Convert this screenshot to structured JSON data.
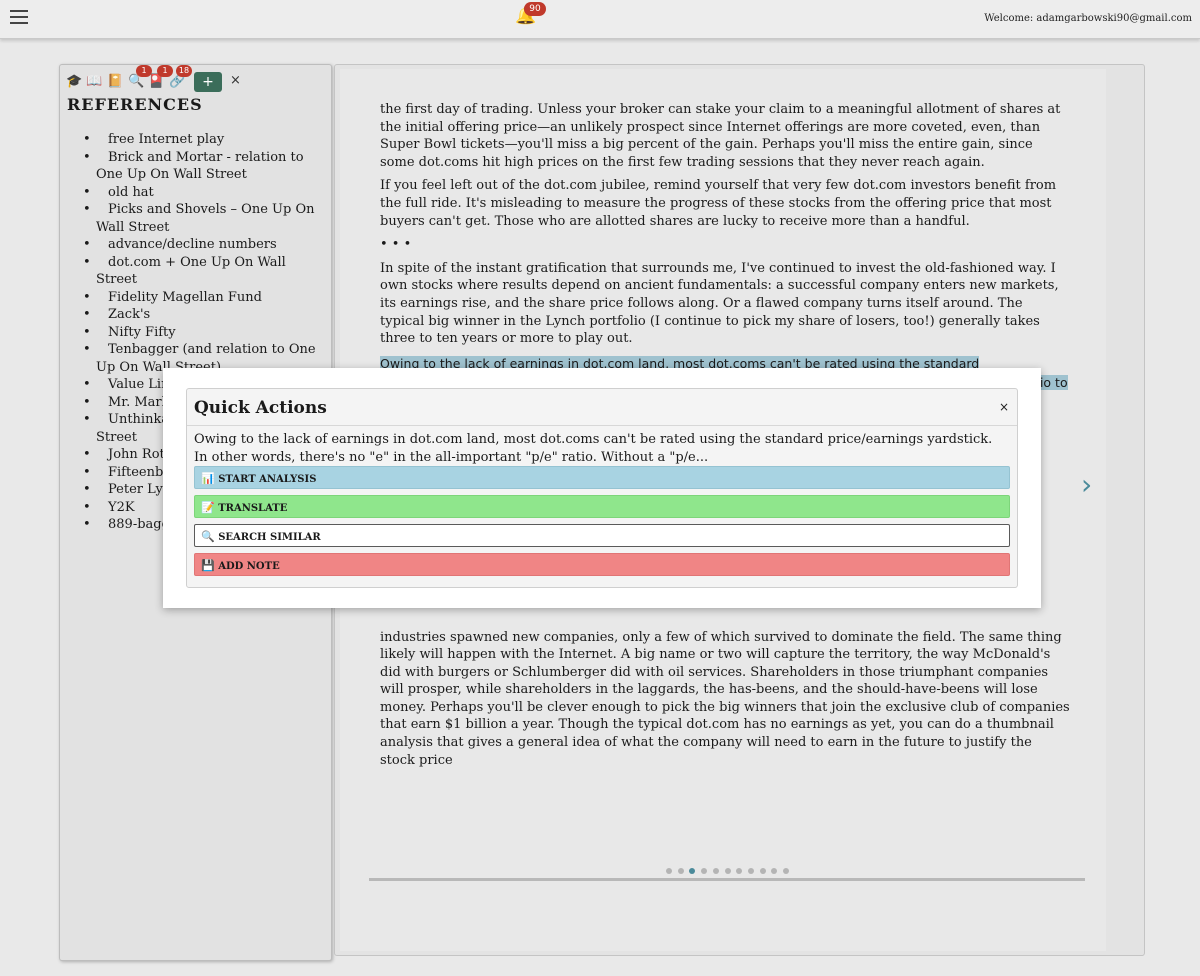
{
  "header": {
    "notification_count": "90",
    "welcome_text": "Welcome: adamgarbowski90@gmail.com"
  },
  "sidebar": {
    "toolbar": {
      "icons": [
        "graduation-cap-icon",
        "open-book-icon",
        "notebook-icon",
        "magnifier-icon",
        "flashcard-icon",
        "link-icon"
      ],
      "badges": [
        "1",
        "1",
        "18"
      ],
      "add_label": "+",
      "close_label": "×"
    },
    "heading": "REFERENCES",
    "items": [
      "free Internet play",
      "Brick and Mortar - relation to One Up On Wall Street",
      "old hat",
      "Picks and Shovels – One Up On Wall Street",
      "advance/decline numbers",
      "dot.com + One Up On Wall Street",
      "Fidelity Magellan Fund",
      "Zack's",
      "Nifty Fifty",
      "Tenbagger (and relation to One Up On Wall Street)",
      "Value Line",
      "Mr. Market",
      "Unthinkable – One Up On Wall Street",
      "John Rothchild",
      "Fifteenbagger",
      "Peter Lynch",
      "Y2K",
      "889-bagger"
    ]
  },
  "reader": {
    "paragraphs": [
      "the first day of trading. Unless your broker can stake your claim to a meaningful allotment of shares at the initial offering price—an unlikely prospect since Internet offerings are more coveted, even, than Super Bowl tickets—you'll miss a big percent of the gain. Perhaps you'll miss the entire gain, since some dot.coms hit high prices on the first few trading sessions that they never reach again.",
      "If you feel left out of the dot.com jubilee, remind yourself that very few dot.com investors benefit from the full ride. It's misleading to measure the progress of these stocks from the offering price that most buyers can't get. Those who are allotted shares are lucky to receive more than a handful.",
      "• • •",
      "In spite of the instant gratification that surrounds me, I've continued to invest the old-fashioned way. I own stocks where results depend on ancient fundamentals: a successful company enters new markets, its earnings rise, and the share price follows along. Or a flawed company turns itself around. The typical big winner in the Lynch portfolio (I continue to pick my share of losers, too!) generally takes three to ten years or more to play out.",
      "Owing to the lack of earnings in dot.com land, most dot.coms can't be rated using the standard price/earnings yardstick. In other words, there's no \"e\" in the all-important \"p/e\" ratio. Without a \"p/e\" ratio to track, investors focus on the one bit of data that shows",
      "industries spawned new companies, only a few of which survived to dominate the field. The same thing likely will happen with the Internet. A big name or two will capture the territory, the way McDonald's did with burgers or Schlumberger did with oil services. Shareholders in those triumphant companies will prosper, while shareholders in the laggards, the has-beens, and the should-have-beens will lose money. Perhaps you'll be clever enough to pick the big winners that join the exclusive club of companies that earn $1 billion a year.        Though the typical dot.com has no earnings as yet, you can do a thumbnail analysis that gives a general idea of what the company will need to earn in the future to justify the stock price"
    ],
    "page_count": 11,
    "current_page": 3
  },
  "modal": {
    "title": "Quick Actions",
    "close_label": "×",
    "quote": "Owing to the lack of earnings in dot.com land, most dot.coms can't be rated using the standard price/earnings yardstick. In other words, there's no \"e\" in the all-important \"p/e\" ratio. Without a \"p/e...",
    "actions": [
      {
        "icon": "📊",
        "label": "START ANALYSIS",
        "icon_name": "bar-chart-icon"
      },
      {
        "icon": "📝",
        "label": "TRANSLATE",
        "icon_name": "memo-icon"
      },
      {
        "icon": "🔍",
        "label": "SEARCH SIMILAR",
        "icon_name": "magnifier-icon"
      },
      {
        "icon": "💾",
        "label": "ADD NOTE",
        "icon_name": "floppy-disk-icon"
      }
    ]
  }
}
